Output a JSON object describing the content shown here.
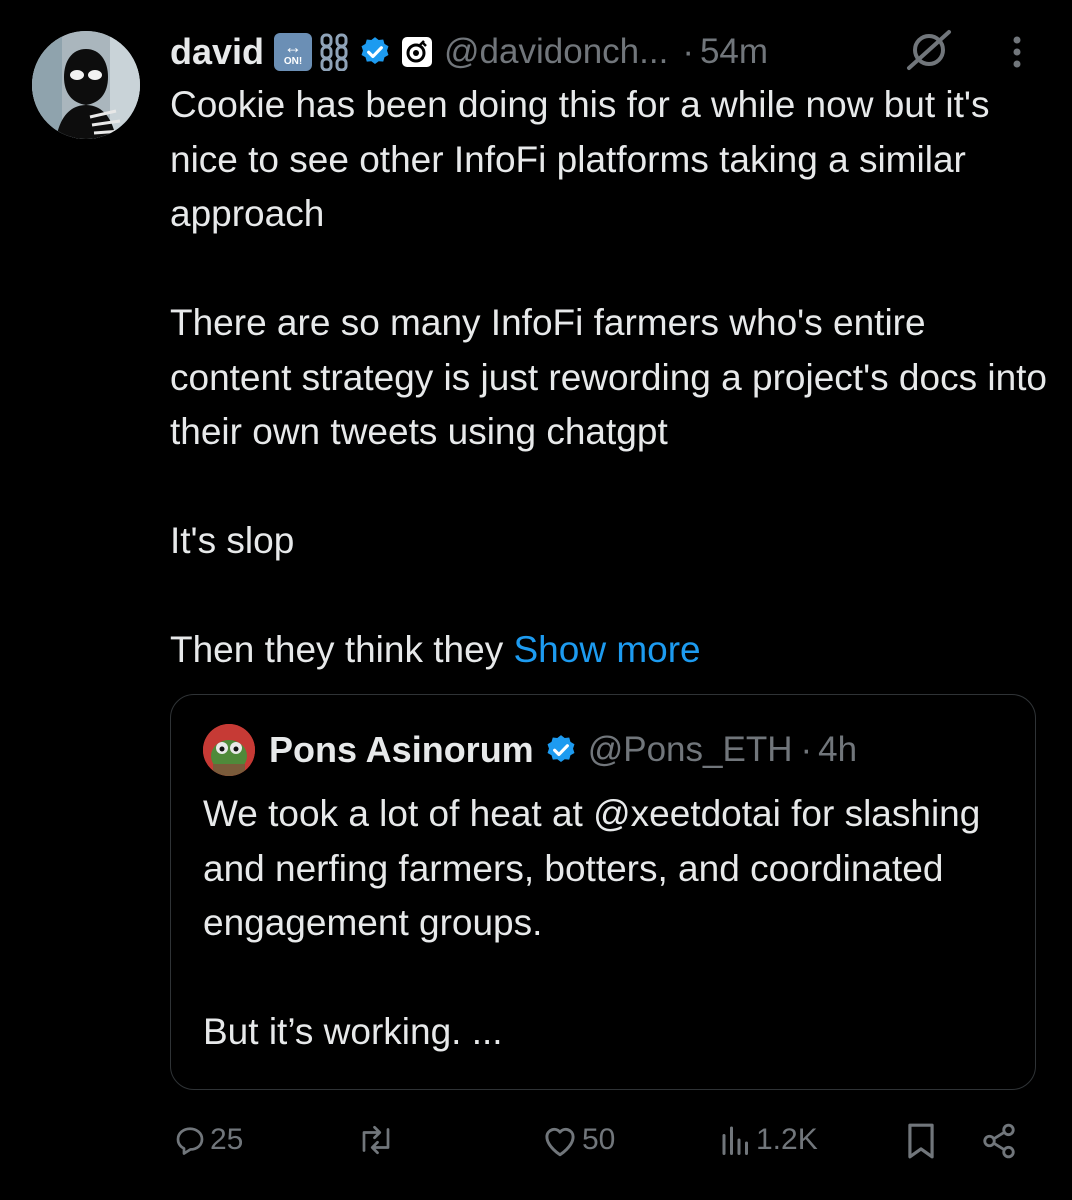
{
  "tweet": {
    "author_name": "david",
    "handle": "@davidonch...",
    "separator": "·",
    "time": "54m",
    "emoji_badge_text": "ON!",
    "paragraphs": [
      "Cookie has been doing this for a while now but it's nice to see other InfoFi platforms taking a similar approach",
      "There are so many InfoFi farmers who's entire content strategy is just rewording a project's docs into their own tweets using chatgpt",
      "It's slop"
    ],
    "truncated_line": "Then they think they ",
    "show_more": "Show more"
  },
  "quote": {
    "author_name": "Pons Asinorum",
    "handle": "@Pons_ETH",
    "separator": "·",
    "time": "4h",
    "paragraph1": "We took a lot of heat at @xeetdotai for slashing and nerfing farmers, botters, and coordinated engagement groups.",
    "paragraph2": "But it’s working. ..."
  },
  "actions": {
    "replies": "25",
    "likes": "50",
    "views": "1.2K"
  },
  "colors": {
    "background": "#000000",
    "text": "#e7e9ea",
    "muted": "#71767b",
    "accent": "#1d9bf0",
    "border": "#2f3336"
  },
  "icons": [
    "chain-icon",
    "verified-icon",
    "grok-icon",
    "more-icon",
    "reply-icon",
    "repost-icon",
    "like-icon",
    "views-icon",
    "bookmark-icon",
    "share-icon"
  ]
}
